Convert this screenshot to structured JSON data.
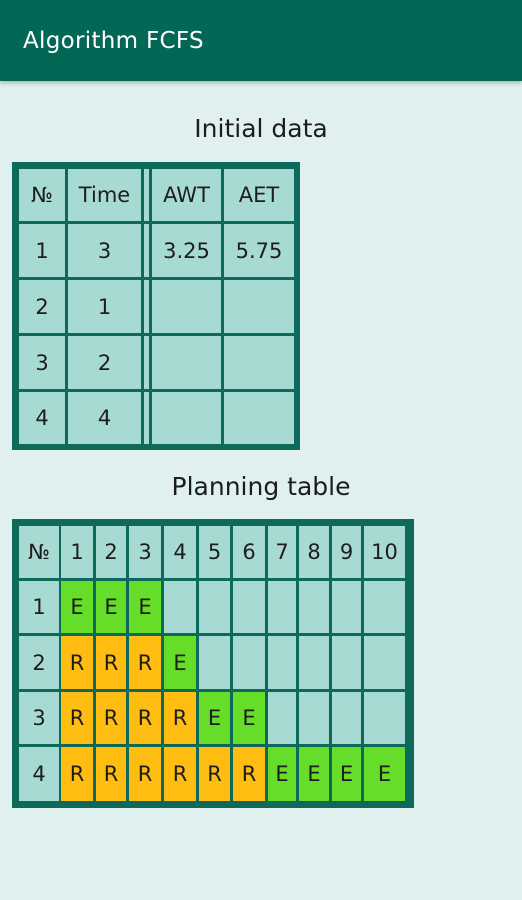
{
  "appbar": {
    "title": "Algorithm FCFS"
  },
  "initial": {
    "title": "Initial data",
    "headers": {
      "no": "№",
      "time": "Time",
      "awt": "AWT",
      "aet": "AET"
    },
    "rows": [
      {
        "no": "1",
        "time": "3",
        "awt": "3.25",
        "aet": "5.75"
      },
      {
        "no": "2",
        "time": "1",
        "awt": "",
        "aet": ""
      },
      {
        "no": "3",
        "time": "2",
        "awt": "",
        "aet": ""
      },
      {
        "no": "4",
        "time": "4",
        "awt": "",
        "aet": ""
      }
    ]
  },
  "planning": {
    "title": "Planning table",
    "no_header": "№",
    "time_headers": [
      "1",
      "2",
      "3",
      "4",
      "5",
      "6",
      "7",
      "8",
      "9",
      "10"
    ],
    "rows": [
      {
        "no": "1",
        "cells": [
          "E",
          "E",
          "E",
          "",
          "",
          "",
          "",
          "",
          "",
          ""
        ]
      },
      {
        "no": "2",
        "cells": [
          "R",
          "R",
          "R",
          "E",
          "",
          "",
          "",
          "",
          "",
          ""
        ]
      },
      {
        "no": "3",
        "cells": [
          "R",
          "R",
          "R",
          "R",
          "E",
          "E",
          "",
          "",
          "",
          ""
        ]
      },
      {
        "no": "4",
        "cells": [
          "R",
          "R",
          "R",
          "R",
          "R",
          "R",
          "E",
          "E",
          "E",
          "E"
        ]
      }
    ]
  },
  "colors": {
    "appbar": "#036756",
    "background": "#dff0ee",
    "grid_border": "#0d6a5b",
    "cell": "#a8dad4",
    "executing": "#66dd28",
    "ready": "#ffbd12"
  }
}
